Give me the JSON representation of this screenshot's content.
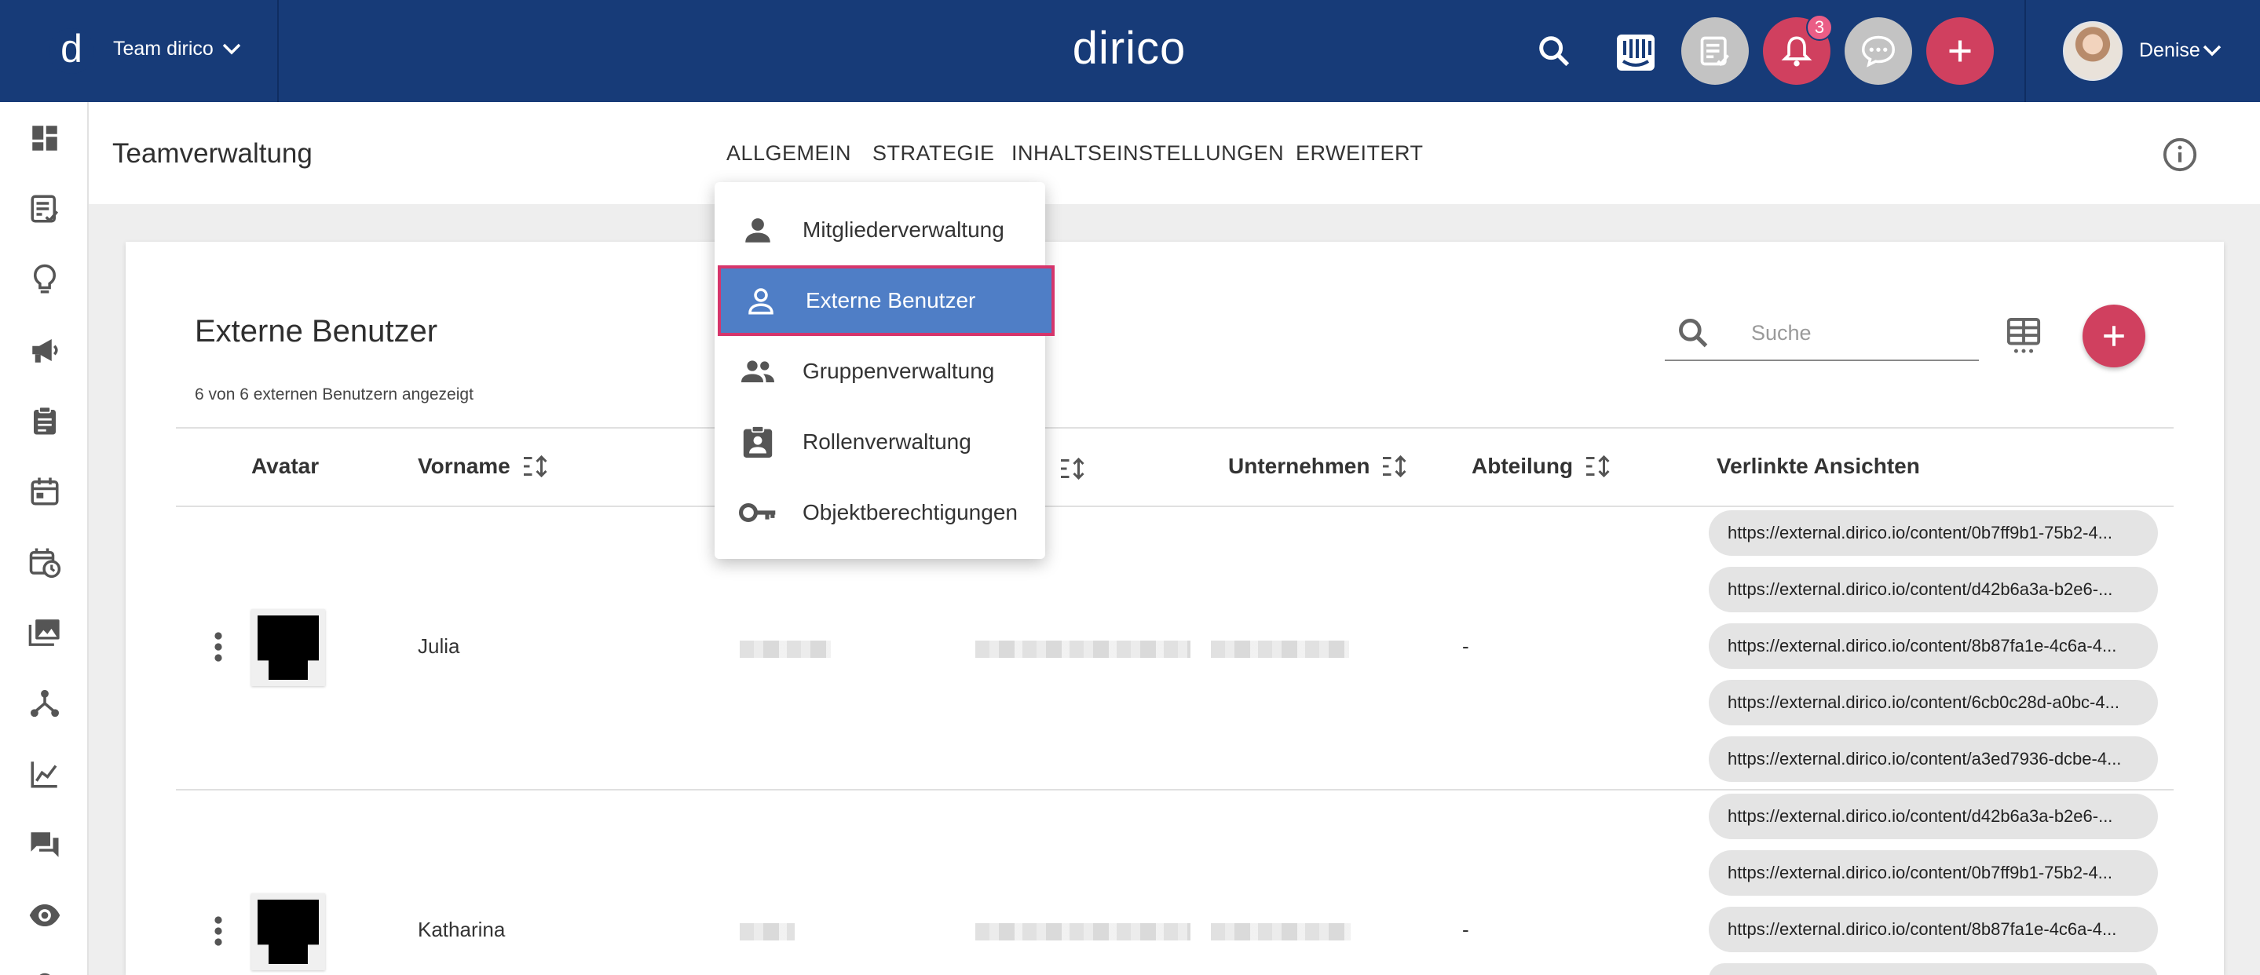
{
  "topbar": {
    "brand_letter": "d",
    "team_name": "Team dirico",
    "app_title": "dirico",
    "notification_count": "3",
    "user_name": "Denise"
  },
  "subheader": {
    "page_title": "Teamverwaltung",
    "tabs": [
      {
        "label": "ALLGEMEIN"
      },
      {
        "label": "STRATEGIE"
      },
      {
        "label": "INHALTSEINSTELLUNGEN"
      },
      {
        "label": "ERWEITERT"
      }
    ]
  },
  "dropdown": {
    "items": [
      {
        "label": "Mitgliederverwaltung",
        "icon": "person-icon"
      },
      {
        "label": "Externe Benutzer",
        "icon": "person-outline-icon",
        "selected": true
      },
      {
        "label": "Gruppenverwaltung",
        "icon": "group-icon"
      },
      {
        "label": "Rollenverwaltung",
        "icon": "assignment-ind-icon"
      },
      {
        "label": "Objektberechtigungen",
        "icon": "key-icon"
      }
    ]
  },
  "card": {
    "title": "Externe Benutzer",
    "subtitle": "6 von 6 externen Benutzern angezeigt",
    "search_placeholder": "Suche"
  },
  "table": {
    "columns": [
      {
        "label": "Avatar"
      },
      {
        "label": "Vorname"
      },
      {
        "label": "Unternehmen"
      },
      {
        "label": "Abteilung"
      },
      {
        "label": "Verlinkte Ansichten"
      }
    ],
    "rows": [
      {
        "first_name": "Julia",
        "department": "-",
        "links": [
          "https://external.dirico.io/content/0b7ff9b1-75b2-4...",
          "https://external.dirico.io/content/d42b6a3a-b2e6-...",
          "https://external.dirico.io/content/8b87fa1e-4c6a-4...",
          "https://external.dirico.io/content/6cb0c28d-a0bc-4...",
          "https://external.dirico.io/content/a3ed7936-dcbe-4..."
        ]
      },
      {
        "first_name": "Katharina",
        "department": "-",
        "links": [
          "https://external.dirico.io/content/d42b6a3a-b2e6-...",
          "https://external.dirico.io/content/0b7ff9b1-75b2-4...",
          "https://external.dirico.io/content/8b87fa1e-4c6a-4..."
        ]
      }
    ]
  },
  "colors": {
    "topbar": "#173b78",
    "accent": "#d0405f",
    "selected_item": "#4f7ec6",
    "selected_border": "#d6356b"
  }
}
